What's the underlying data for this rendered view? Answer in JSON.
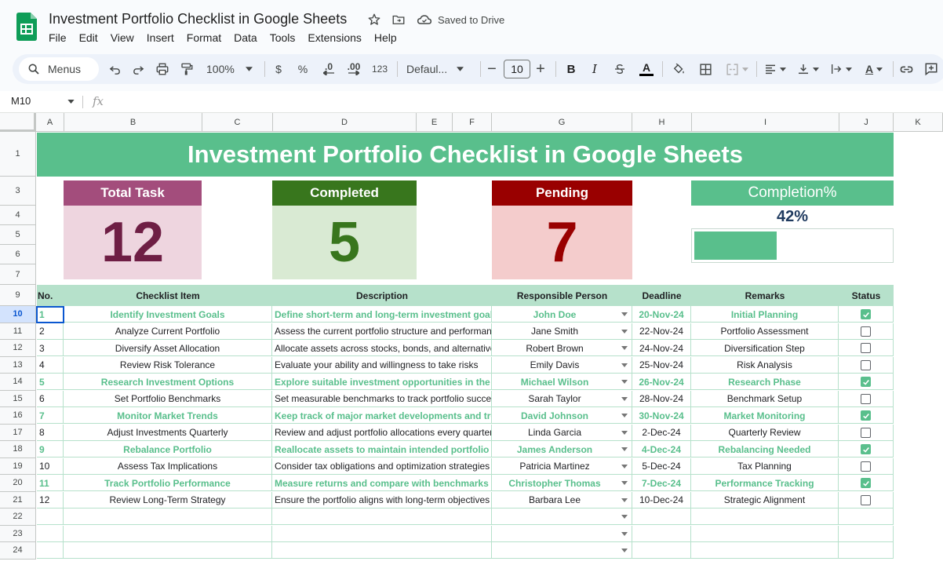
{
  "app": {
    "doc_title": "Investment Portfolio Checklist in Google Sheets",
    "saved_status": "Saved to Drive",
    "menu": [
      "File",
      "Edit",
      "View",
      "Insert",
      "Format",
      "Data",
      "Tools",
      "Extensions",
      "Help"
    ]
  },
  "toolbar": {
    "search_label": "Menus",
    "zoom": "100%",
    "currency": "$",
    "percent": "%",
    "decrease_decimal": ".0",
    "increase_decimal": ".00",
    "number_format": "123",
    "font_family": "Defaul...",
    "font_size": "10"
  },
  "formula_bar": {
    "cell_ref": "M10",
    "fx": "fx"
  },
  "columns": [
    "A",
    "B",
    "C",
    "D",
    "E",
    "F",
    "G",
    "H",
    "I",
    "J",
    "K"
  ],
  "rows": [
    "1",
    "3",
    "4",
    "5",
    "6",
    "7",
    "9",
    "10",
    "11",
    "12",
    "13",
    "14",
    "15",
    "16",
    "17",
    "18",
    "19",
    "20",
    "21",
    "22",
    "23",
    "24"
  ],
  "sheet": {
    "banner_title": "Investment Portfolio Checklist in Google Sheets",
    "kpis": {
      "total": {
        "label": "Total Task",
        "value": "12",
        "head_color": "#a34d7c",
        "body_color": "#eed5df",
        "value_color": "#6e1e44"
      },
      "completed": {
        "label": "Completed",
        "value": "5",
        "head_color": "#38761d",
        "body_color": "#d9ead3",
        "value_color": "#38761d"
      },
      "pending": {
        "label": "Pending",
        "value": "7",
        "head_color": "#990000",
        "body_color": "#f4cccc",
        "value_color": "#990000"
      },
      "completion": {
        "label": "Completion%",
        "value": "42%",
        "fraction": 0.42,
        "head_color": "#59bf8c"
      }
    },
    "table_headers": {
      "no": "No.",
      "item": "Checklist Item",
      "description": "Description",
      "person": "Responsible Person",
      "deadline": "Deadline",
      "remarks": "Remarks",
      "status": "Status"
    },
    "tasks": [
      {
        "no": "1",
        "item": "Identify Investment Goals",
        "description": "Define short-term and long-term investment goals",
        "person": "John Doe",
        "deadline": "20-Nov-24",
        "remarks": "Initial Planning",
        "done": true
      },
      {
        "no": "2",
        "item": "Analyze Current Portfolio",
        "description": "Assess the current portfolio structure and performance",
        "person": "Jane Smith",
        "deadline": "22-Nov-24",
        "remarks": "Portfolio Assessment",
        "done": false
      },
      {
        "no": "3",
        "item": "Diversify Asset Allocation",
        "description": "Allocate assets across stocks, bonds, and alternatives",
        "person": "Robert Brown",
        "deadline": "24-Nov-24",
        "remarks": "Diversification Step",
        "done": false
      },
      {
        "no": "4",
        "item": "Review Risk Tolerance",
        "description": "Evaluate your ability and willingness to take risks",
        "person": "Emily Davis",
        "deadline": "25-Nov-24",
        "remarks": "Risk Analysis",
        "done": false
      },
      {
        "no": "5",
        "item": "Research Investment Options",
        "description": "Explore suitable investment opportunities in the market",
        "person": "Michael Wilson",
        "deadline": "26-Nov-24",
        "remarks": "Research Phase",
        "done": true
      },
      {
        "no": "6",
        "item": "Set Portfolio Benchmarks",
        "description": "Set measurable benchmarks to track portfolio success",
        "person": "Sarah Taylor",
        "deadline": "28-Nov-24",
        "remarks": "Benchmark Setup",
        "done": false
      },
      {
        "no": "7",
        "item": "Monitor Market Trends",
        "description": "Keep track of major market developments and trends",
        "person": "David Johnson",
        "deadline": "30-Nov-24",
        "remarks": "Market Monitoring",
        "done": true
      },
      {
        "no": "8",
        "item": "Adjust Investments Quarterly",
        "description": "Review and adjust portfolio allocations every quarter",
        "person": "Linda Garcia",
        "deadline": "2-Dec-24",
        "remarks": "Quarterly Review",
        "done": false
      },
      {
        "no": "9",
        "item": "Rebalance Portfolio",
        "description": "Reallocate assets to maintain intended portfolio mix",
        "person": "James Anderson",
        "deadline": "4-Dec-24",
        "remarks": "Rebalancing Needed",
        "done": true
      },
      {
        "no": "10",
        "item": "Assess Tax Implications",
        "description": "Consider tax obligations and optimization strategies",
        "person": "Patricia Martinez",
        "deadline": "5-Dec-24",
        "remarks": "Tax Planning",
        "done": false
      },
      {
        "no": "11",
        "item": "Track Portfolio Performance",
        "description": "Measure returns and compare with benchmarks",
        "person": "Christopher Thomas",
        "deadline": "7-Dec-24",
        "remarks": "Performance Tracking",
        "done": true
      },
      {
        "no": "12",
        "item": "Review Long-Term Strategy",
        "description": "Ensure the portfolio aligns with long-term objectives",
        "person": "Barbara Lee",
        "deadline": "10-Dec-24",
        "remarks": "Strategic Alignment",
        "done": false
      }
    ],
    "accent_color": "#59bf8c"
  }
}
